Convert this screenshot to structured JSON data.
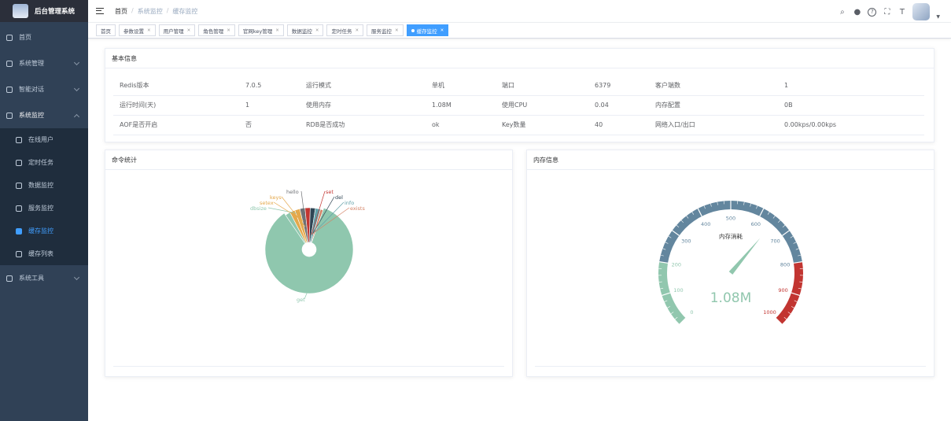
{
  "sidebar": {
    "title": "后台管理系统",
    "items": [
      "首页",
      "系统管理",
      "智能对话",
      "系统监控",
      "在线用户",
      "定时任务",
      "数据监控",
      "服务监控",
      "缓存监控",
      "缓存列表",
      "系统工具"
    ]
  },
  "breadcrumb": [
    "首页",
    "系统监控",
    "缓存监控"
  ],
  "tags": [
    "首页",
    "参数设置",
    "用户管理",
    "角色管理",
    "官网key管理",
    "数据监控",
    "定时任务",
    "服务监控",
    "缓存监控"
  ],
  "basic": {
    "title": "基本信息",
    "rows": [
      [
        "Redis版本",
        "7.0.5",
        "运行模式",
        "单机",
        "端口",
        "6379",
        "客户端数",
        "1"
      ],
      [
        "运行时间(天)",
        "1",
        "使用内存",
        "1.08M",
        "使用CPU",
        "0.04",
        "内存配置",
        "0B"
      ],
      [
        "AOF是否开启",
        "否",
        "RDB是否成功",
        "ok",
        "Key数量",
        "40",
        "网络入口/出口",
        "0.00kps/0.00kps"
      ]
    ]
  },
  "commands": {
    "title": "命令统计",
    "labels": [
      "hello",
      "set",
      "keys",
      "del",
      "setex",
      "info",
      "dbsize",
      "exists",
      "get"
    ]
  },
  "memory": {
    "title": "内存信息",
    "gauge_title": "内存消耗",
    "value_text": "1.08M",
    "ticks": [
      "0",
      "100",
      "200",
      "300",
      "400",
      "500",
      "600",
      "700",
      "800",
      "900",
      "1000"
    ]
  },
  "chart_data": [
    {
      "type": "pie",
      "title": "命令统计",
      "categories": [
        "get",
        "dbsize",
        "setex",
        "keys",
        "hello",
        "set",
        "del",
        "info",
        "exists"
      ],
      "values": [
        85,
        2,
        2,
        2,
        2,
        2,
        2,
        2,
        1
      ],
      "colors": [
        "#8fc7ae",
        "#8fc7ae",
        "#e4a84b",
        "#e4a84b",
        "#6e7074",
        "#c23531",
        "#2f4554",
        "#61a0a8",
        "#d48265"
      ]
    },
    {
      "type": "gauge",
      "title": "内存消耗",
      "min": 0,
      "max": 1000,
      "value": 1.08,
      "bands": [
        {
          "to": 200,
          "color": "#91c7ae"
        },
        {
          "to": 800,
          "color": "#63869e"
        },
        {
          "to": 1000,
          "color": "#c23531"
        }
      ]
    }
  ]
}
